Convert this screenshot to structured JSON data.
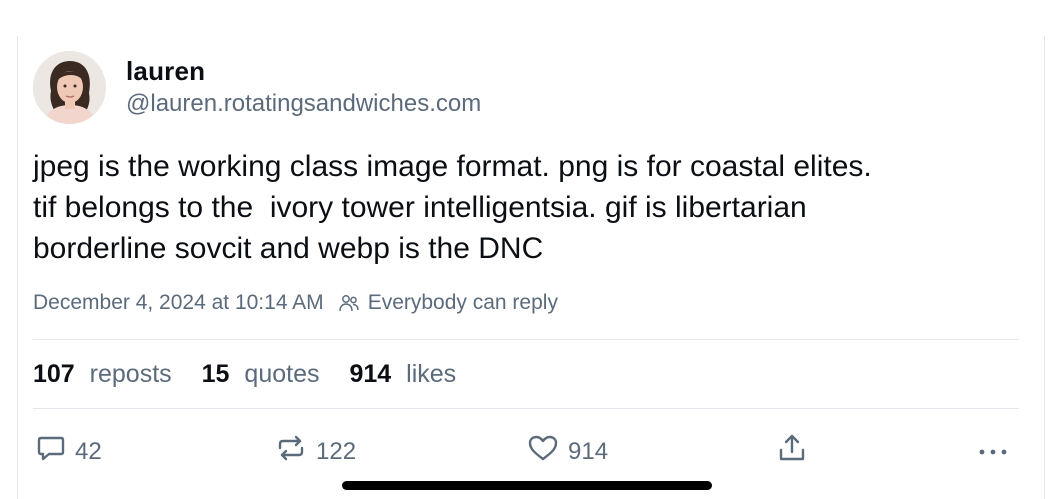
{
  "author": {
    "display_name": "lauren",
    "handle": "@lauren.rotatingsandwiches.com"
  },
  "post": {
    "text": "jpeg is the working class image format. png is for coastal elites.\ntif belongs to the  ivory tower intelligentsia. gif is libertarian\nborderline sovcit and webp is the DNC",
    "timestamp": "December 4, 2024 at 10:14 AM",
    "reply_setting": "Everybody can reply"
  },
  "stats": {
    "reposts_count": "107",
    "reposts_label": "reposts",
    "quotes_count": "15",
    "quotes_label": "quotes",
    "likes_count": "914",
    "likes_label": "likes"
  },
  "actions": {
    "reply_count": "42",
    "repost_count": "122",
    "like_count": "914"
  },
  "icons": {
    "reply": "speech-bubble-icon",
    "repost": "repost-arrows-icon",
    "like": "heart-icon",
    "share": "share-upload-icon",
    "more": "ellipsis-icon",
    "reply_setting": "people-icon"
  },
  "colors": {
    "text": "#0b0f14",
    "muted": "#5b6b7c",
    "divider": "#e3e6ea"
  }
}
